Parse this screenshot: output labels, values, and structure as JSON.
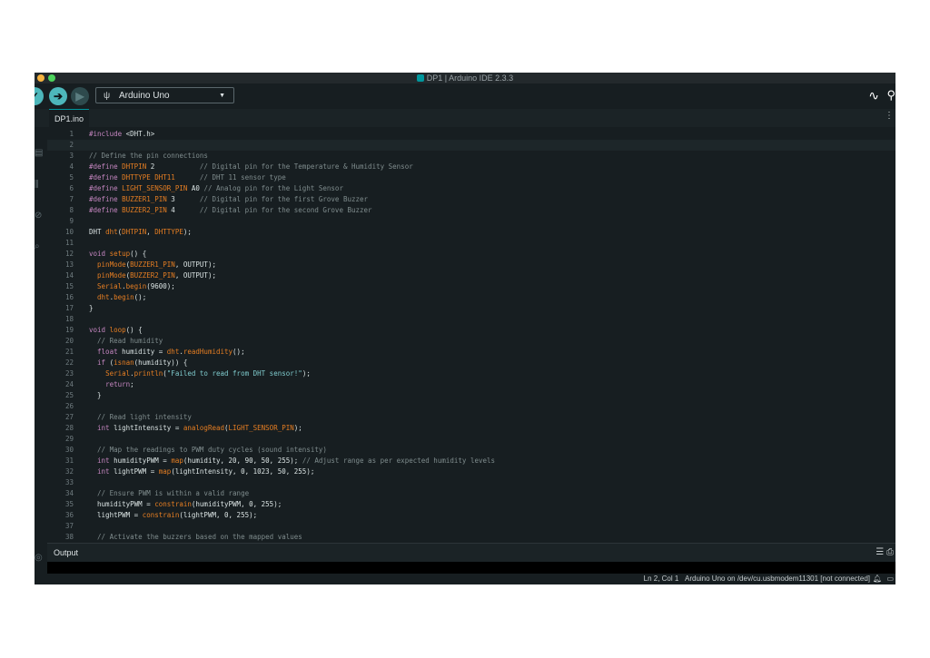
{
  "window": {
    "title": "DP1 | Arduino IDE 2.3.3"
  },
  "toolbar": {
    "board": "Arduino Uno",
    "icons": [
      "verify-icon",
      "upload-icon",
      "debug-icon",
      "usb-icon",
      "chevron-down-icon",
      "serial-plotter-icon",
      "serial-monitor-icon"
    ]
  },
  "tab": {
    "name": "DP1.ino"
  },
  "colors": {
    "background": "#171e21",
    "accent": "#00979d",
    "upload": "#4db7bb",
    "keyword": "#c586c0",
    "function": "#e67e22",
    "comment": "#7f8c8d"
  },
  "code": {
    "lines": [
      {
        "n": "1",
        "text": "#include <DHT.h>"
      },
      {
        "n": "2",
        "text": ""
      },
      {
        "n": "3",
        "text": "// Define the pin connections"
      },
      {
        "n": "4",
        "text": "#define DHTPIN 2           // Digital pin for the Temperature & Humidity Sensor"
      },
      {
        "n": "5",
        "text": "#define DHTTYPE DHT11      // DHT 11 sensor type"
      },
      {
        "n": "6",
        "text": "#define LIGHT_SENSOR_PIN A0 // Analog pin for the Light Sensor"
      },
      {
        "n": "7",
        "text": "#define BUZZER1_PIN 3      // Digital pin for the first Grove Buzzer"
      },
      {
        "n": "8",
        "text": "#define BUZZER2_PIN 4      // Digital pin for the second Grove Buzzer"
      },
      {
        "n": "9",
        "text": ""
      },
      {
        "n": "10",
        "text": "DHT dht(DHTPIN, DHTTYPE);"
      },
      {
        "n": "11",
        "text": ""
      },
      {
        "n": "12",
        "text": "void setup() {"
      },
      {
        "n": "13",
        "text": "  pinMode(BUZZER1_PIN, OUTPUT);"
      },
      {
        "n": "14",
        "text": "  pinMode(BUZZER2_PIN, OUTPUT);"
      },
      {
        "n": "15",
        "text": "  Serial.begin(9600);"
      },
      {
        "n": "16",
        "text": "  dht.begin();"
      },
      {
        "n": "17",
        "text": "}"
      },
      {
        "n": "18",
        "text": ""
      },
      {
        "n": "19",
        "text": "void loop() {"
      },
      {
        "n": "20",
        "text": "  // Read humidity"
      },
      {
        "n": "21",
        "text": "  float humidity = dht.readHumidity();"
      },
      {
        "n": "22",
        "text": "  if (isnan(humidity)) {"
      },
      {
        "n": "23",
        "text": "    Serial.println(\"Failed to read from DHT sensor!\");"
      },
      {
        "n": "24",
        "text": "    return;"
      },
      {
        "n": "25",
        "text": "  }"
      },
      {
        "n": "26",
        "text": ""
      },
      {
        "n": "27",
        "text": "  // Read light intensity"
      },
      {
        "n": "28",
        "text": "  int lightIntensity = analogRead(LIGHT_SENSOR_PIN);"
      },
      {
        "n": "29",
        "text": ""
      },
      {
        "n": "30",
        "text": "  // Map the readings to PWM duty cycles (sound intensity)"
      },
      {
        "n": "31",
        "text": "  int humidityPWM = map(humidity, 20, 90, 50, 255); // Adjust range as per expected humidity levels"
      },
      {
        "n": "32",
        "text": "  int lightPWM = map(lightIntensity, 0, 1023, 50, 255);"
      },
      {
        "n": "33",
        "text": ""
      },
      {
        "n": "34",
        "text": "  // Ensure PWM is within a valid range"
      },
      {
        "n": "35",
        "text": "  humidityPWM = constrain(humidityPWM, 0, 255);"
      },
      {
        "n": "36",
        "text": "  lightPWM = constrain(lightPWM, 0, 255);"
      },
      {
        "n": "37",
        "text": ""
      },
      {
        "n": "38",
        "text": "  // Activate the buzzers based on the mapped values"
      }
    ]
  },
  "output": {
    "label": "Output"
  },
  "status": {
    "position": "Ln 2, Col 1",
    "board_port": "Arduino Uno on /dev/cu.usbmodem11301 [not connected]"
  }
}
